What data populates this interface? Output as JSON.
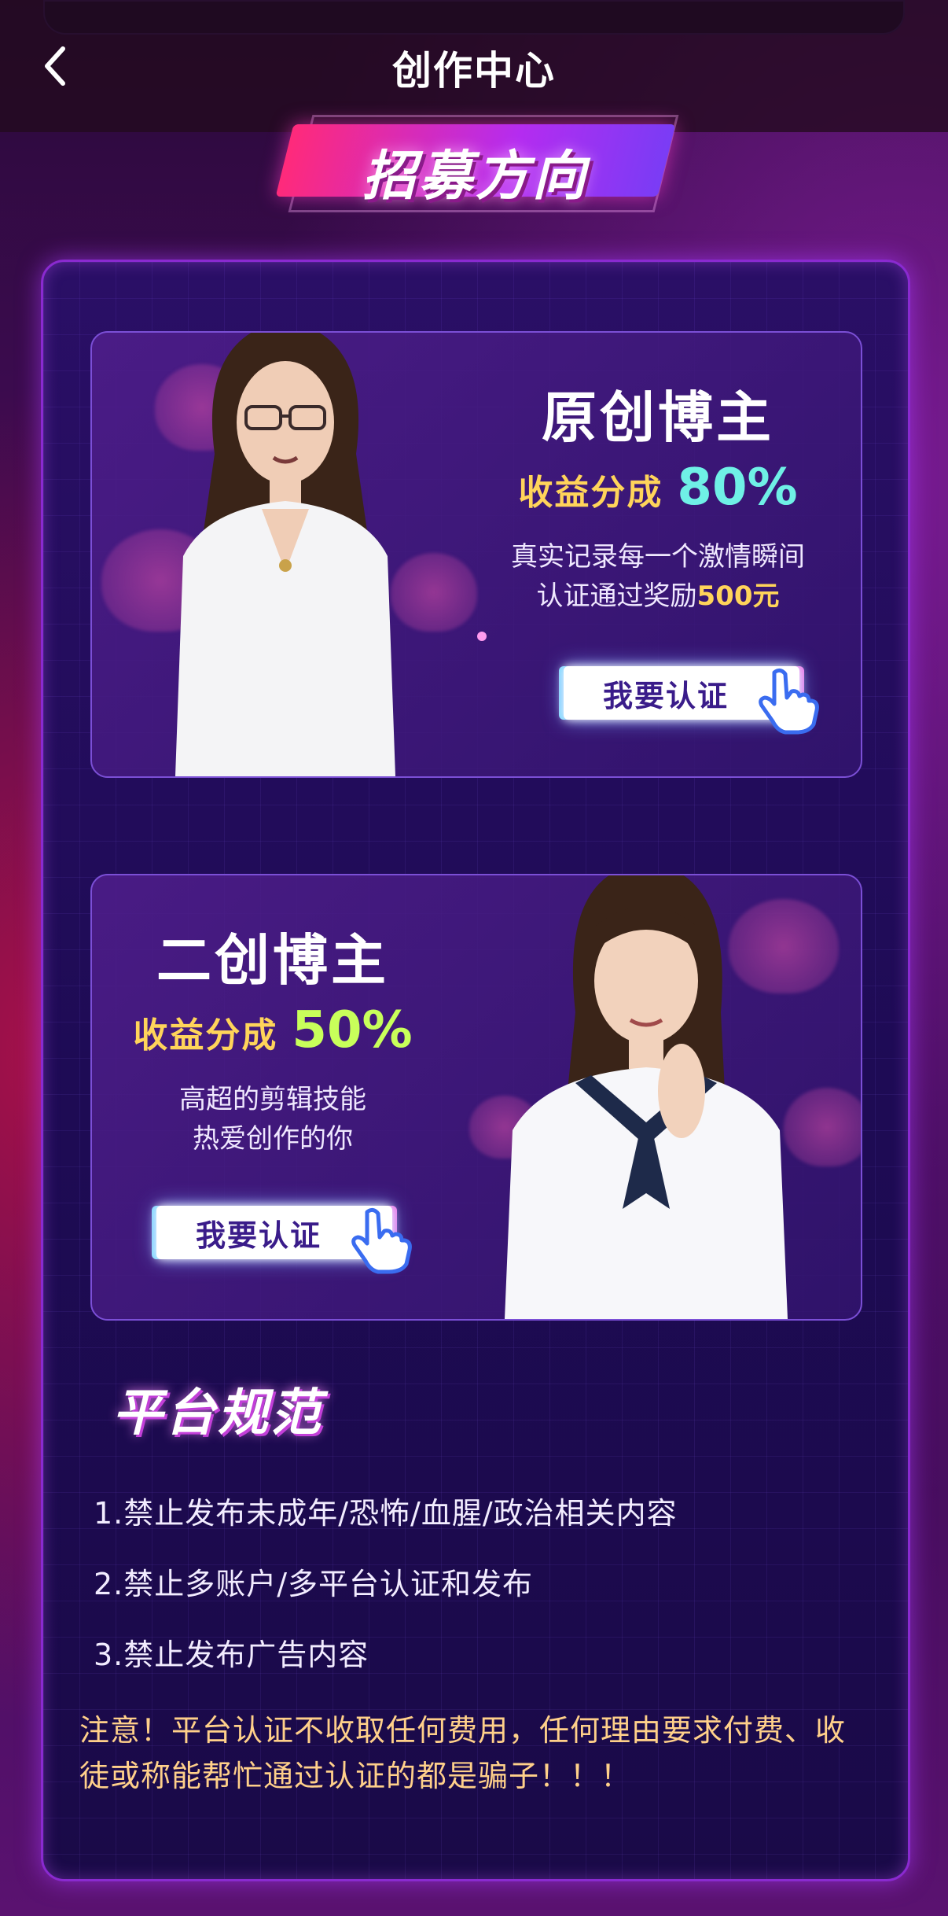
{
  "header": {
    "title": "创作中心",
    "back_icon": "chevron-left-icon"
  },
  "banner": {
    "title": "招募方向"
  },
  "cards": [
    {
      "title": "原创博主",
      "revenue_label": "收益分成",
      "revenue_value": "80%",
      "revenue_color": "#6ff0e6",
      "desc_line1": "真实记录每一个激情瞬间",
      "desc_line2_prefix": "认证通过奖励",
      "desc_line2_highlight": "500元",
      "cta_label": "我要认证"
    },
    {
      "title": "二创博主",
      "revenue_label": "收益分成",
      "revenue_value": "50%",
      "revenue_color": "#c8ff5a",
      "desc_line1": "高超的剪辑技能",
      "desc_line2": "热爱创作的你",
      "cta_label": "我要认证"
    }
  ],
  "rules": {
    "title": "平台规范",
    "items": [
      "1.禁止发布未成年/恐怖/血腥/政治相关内容",
      "2.禁止多账户/多平台认证和发布",
      "3.禁止发布广告内容"
    ],
    "warning": "注意！平台认证不收取任何费用，任何理由要求付费、收徒或称能帮忙通过认证的都是骗子！！！"
  },
  "colors": {
    "accent": "#ffd45a",
    "panel_border": "#8a2ad0"
  }
}
